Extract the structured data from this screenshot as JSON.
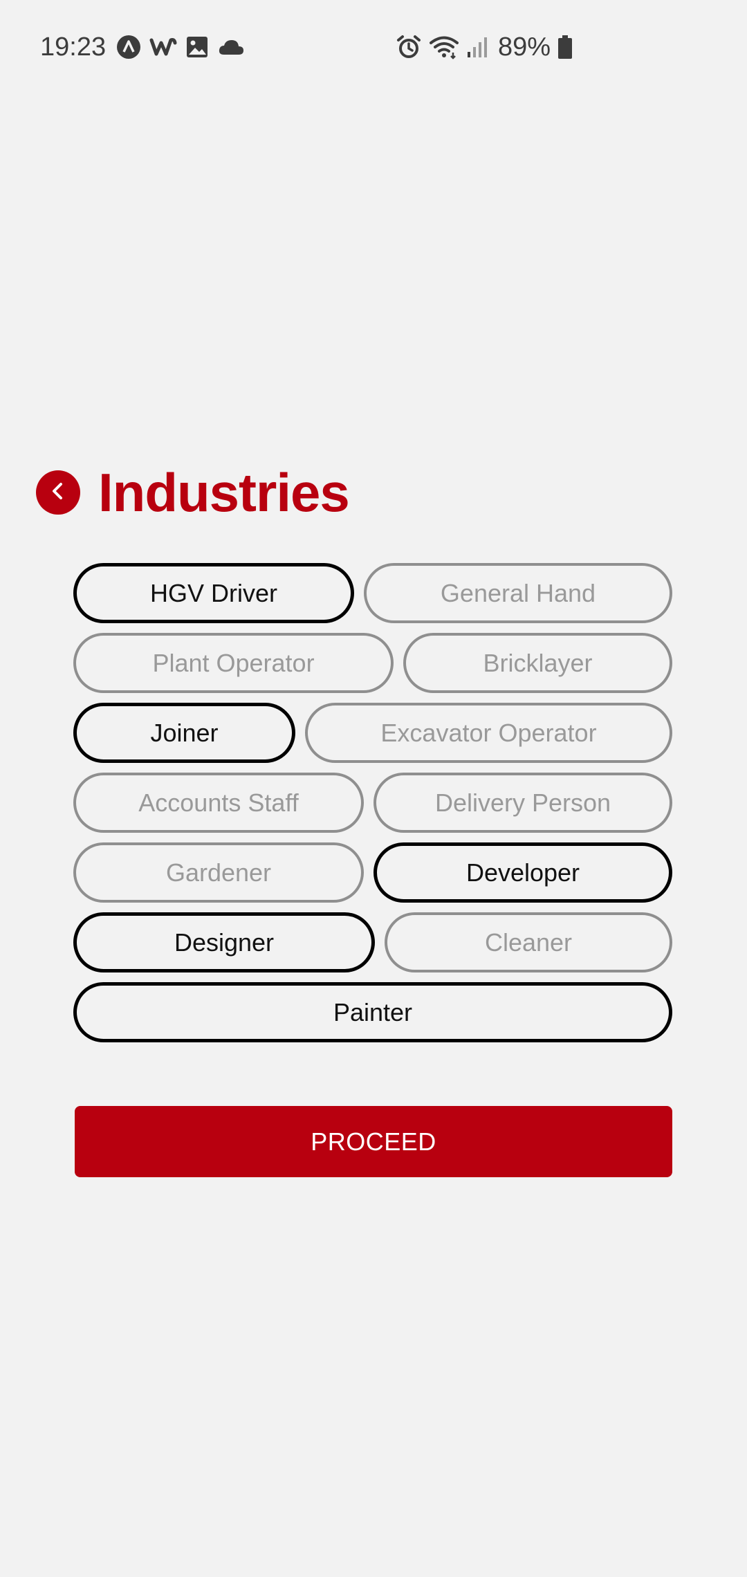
{
  "status_bar": {
    "time": "19:23",
    "battery": "89%",
    "left_icons": [
      "navigation-app-icon",
      "w-app-icon",
      "image-icon",
      "cloud-icon"
    ],
    "right_icons": [
      "alarm-icon",
      "wifi-icon",
      "signal-icon",
      "battery-icon"
    ]
  },
  "header": {
    "title": "Industries",
    "back_icon": "chevron-left-icon"
  },
  "chips": [
    {
      "label": "HGV Driver",
      "selected": true
    },
    {
      "label": "General Hand",
      "selected": false
    },
    {
      "label": "Plant Operator",
      "selected": false
    },
    {
      "label": "Bricklayer",
      "selected": false
    },
    {
      "label": "Joiner",
      "selected": true
    },
    {
      "label": "Excavator Operator",
      "selected": false
    },
    {
      "label": "Accounts Staff",
      "selected": false
    },
    {
      "label": "Delivery Person",
      "selected": false
    },
    {
      "label": "Gardener",
      "selected": false
    },
    {
      "label": "Developer",
      "selected": true
    },
    {
      "label": "Designer",
      "selected": true
    },
    {
      "label": "Cleaner",
      "selected": false
    },
    {
      "label": "Painter",
      "selected": true
    }
  ],
  "proceed_label": "PROCEED",
  "colors": {
    "accent": "#b8000f",
    "background": "#f2f2f2",
    "chip_selected": "#000000",
    "chip_unselected": "#8f8f8f"
  }
}
